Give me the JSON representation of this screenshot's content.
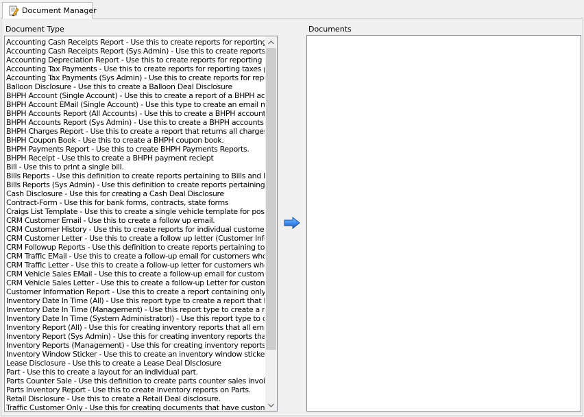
{
  "tab": {
    "label": "Document Manager",
    "icon": "document-manager-icon"
  },
  "document_type": {
    "label": "Document Type",
    "items": [
      "Accounting Cash Receipts Report - Use this to create reports for reporting cash r",
      "Accounting Cash Receipts Report (Sys Admin) - Use this to create reports for rep",
      "Accounting Depreciation Report - Use this to create reports for reporting vehicle",
      "Accounting Tax Payments - Use this to create reports for reporting taxes paid fro",
      "Accounting Tax Payments (Sys Admin) - Use this to create reports for reporting ta",
      "Balloon Disclosure - Use this to create a Balloon Deal Disclosure",
      "BHPH Account (Single Account) - Use this to create a report of a BHPH accoun",
      "BHPH Account EMail (Single Account) - Use this type to create an email messag",
      "BHPH Accounts Report (All Accounts) - Use this to create a BHPH accounts rep",
      "BHPH Accounts Report (Sys Admin) - Use this to create a BHPH accounts repor",
      "BHPH Charges Report - Use this to create a report that returns all charges acros",
      "BHPH Coupon Book - Use this to create a BHPH coupon book.",
      "BHPH Payments Report - Use this to create BHPH Payments Reports.",
      "BHPH Receipt - Use this to create a BHPH payment reciept",
      "Bill - Use this to print a single bill.",
      "Bills Reports - Use this definition to create reports pertaining to Bills and Bills Stat",
      "Bills Reports (Sys Admin) - Use this definition to create reports pertaining to Bills a",
      "Cash Disclosure - Use this for creating a Cash Deal Disclosure",
      "Contract-Form - Use this for bank forms, contracts, state forms",
      "Craigs List Template - Use this to create a single vehicle template for posting on (",
      "CRM Customer Email - Use this to create a follow up email.",
      "CRM Customer History - Use this to create reports for individual customer history",
      "CRM Customer Letter - Use this to create a follow up letter (Customer Info Only)",
      "CRM Followup Reports - Use this definition to create reports pertaining to custom",
      "CRM Traffic EMail - Use this to create a follow-up email for customers who have",
      "CRM Traffic Letter - Use this to create a follow-up letter for customers who have",
      "CRM Vehicle Sales EMail - Use this to create a follow-up email for customers wh",
      "CRM Vehicle Sales Letter - Use this to create a follow-up Letter for customers wh",
      "Customer Information Report - Use this to create a report containing only custom",
      "Inventory Date In Time (All) - Use this report type to create a report that lists inver",
      "Inventory Date In Time (Management) - Use this report type to create a report tha",
      "Inventory Date In Time (System Administratorl) - Use this report type to create a re",
      "Inventory Report (All) - Use this for creating inventory reports that all employees c",
      "Inventory Report (Sys Admin) - Use this for creating inventory reports that only Sy",
      "Inventory Reports (Management) - Use this for creating inventory reports that ma",
      "Inventory Window Sticker - Use this to create an inventory window sticker.",
      "Lease Disclosure - Use this to create a Lease Deal DIsclosure",
      "Part - Use this to create a layout for an individual part.",
      "Parts Counter Sale - Use this definition to create parts counter sales invoices anc",
      "Parts Inventory Report - Use this to create inventory reports on Parts.",
      "Retail Disclosure - Use this to create a Retail Deal disclosure.",
      "Traffic Customer Only - Use this for creating documents that have customer infor"
    ]
  },
  "documents": {
    "label": "Documents",
    "items": []
  },
  "arrow_button": {
    "icon": "right-arrow-icon",
    "color": "#2f7fe0"
  },
  "scrollbar": {
    "up_icon": "scroll-up-icon",
    "down_icon": "scroll-down-icon"
  }
}
